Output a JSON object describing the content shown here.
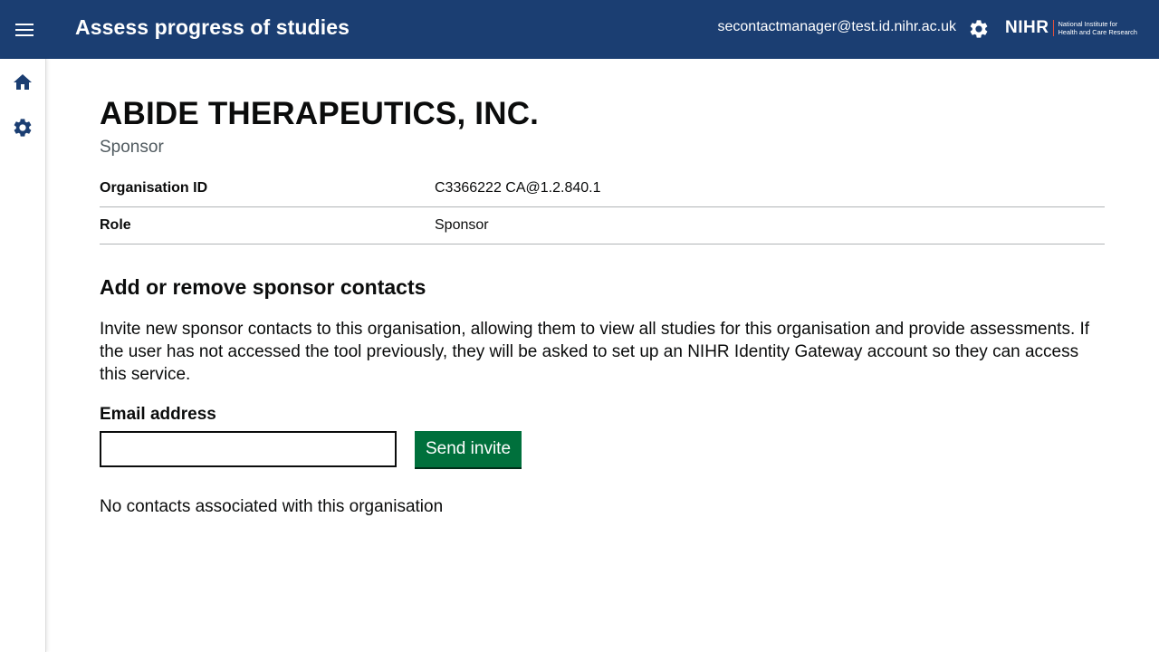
{
  "header": {
    "app_title": "Assess progress of studies",
    "user_email": "secontactmanager@test.id.nihr.ac.uk",
    "logo_mark": "NIHR",
    "logo_line1": "National Institute for",
    "logo_line2": "Health and Care Research",
    "icons": {
      "menu": "menu-icon",
      "settings": "gear-icon"
    }
  },
  "sidebar": {
    "items": [
      {
        "icon": "home-icon"
      },
      {
        "icon": "gear-icon"
      }
    ]
  },
  "organisation": {
    "name": "ABIDE THERAPEUTICS, INC.",
    "caption": "Sponsor",
    "details": [
      {
        "key": "Organisation ID",
        "value": "C3366222 CA@1.2.840.1"
      },
      {
        "key": "Role",
        "value": "Sponsor"
      }
    ]
  },
  "contacts": {
    "heading": "Add or remove sponsor contacts",
    "description": "Invite new sponsor contacts to this organisation, allowing them to view all studies for this organisation and provide assessments. If the user has not accessed the tool previously, they will be asked to set up an NIHR Identity Gateway account so they can access this service.",
    "email_label": "Email address",
    "email_value": "",
    "send_label": "Send invite",
    "empty_message": "No contacts associated with this organisation"
  },
  "colors": {
    "header_bg": "#1b3e72",
    "sidebar_icon": "#1b3e72",
    "primary_button": "#00703c",
    "logo_separator": "#e0503c"
  }
}
